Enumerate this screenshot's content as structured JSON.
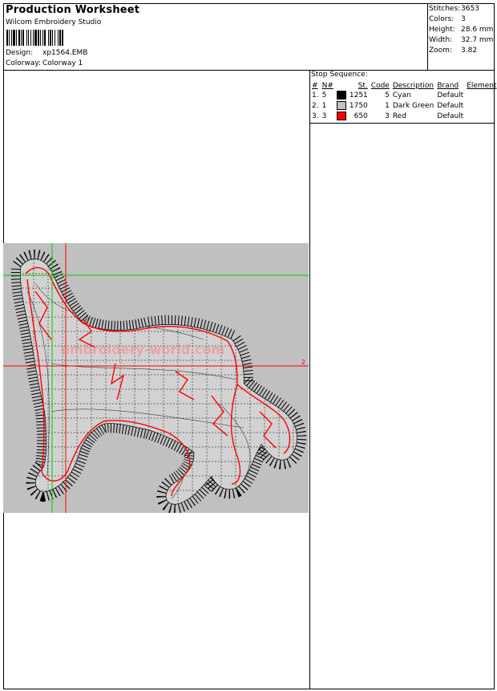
{
  "header": {
    "title": "Production Worksheet",
    "software": "Wilcom  Embroidery Studio",
    "design_label": "Design:",
    "design_value": "xp1564.EMB",
    "colorway_label": "Colorway:",
    "colorway_value": "Colorway 1"
  },
  "stats": [
    {
      "label": "Stitches:",
      "value": "3653"
    },
    {
      "label": "Colors:",
      "value": "3"
    },
    {
      "label": "Height:",
      "value": "28.6 mm"
    },
    {
      "label": "Width:",
      "value": "32.7 mm"
    },
    {
      "label": "Zoom:",
      "value": "3.82"
    }
  ],
  "stop_sequence": {
    "title": "Stop Sequence:",
    "columns": [
      "#",
      "N#",
      "St.",
      "Code",
      "Description",
      "Brand",
      "Element"
    ],
    "rows": [
      {
        "idx": "1.",
        "n": "5",
        "color": "#000000",
        "st": "1251",
        "code": "5",
        "desc": "Cyan",
        "brand": "Default",
        "element": ""
      },
      {
        "idx": "2.",
        "n": "1",
        "color": "#c0c0c0",
        "st": "1750",
        "code": "1",
        "desc": "Dark Green",
        "brand": "Default",
        "element": ""
      },
      {
        "idx": "3.",
        "n": "3",
        "color": "#ff0000",
        "st": "650",
        "code": "3",
        "desc": "Red",
        "brand": "Default",
        "element": ""
      }
    ]
  },
  "preview": {
    "axis_marker": "2",
    "watermark": "embroidery-world.com",
    "colors": {
      "background": "#c0c0c0",
      "stitch": "#000000",
      "outline": "#ff0000",
      "guide_green": "#00cc00",
      "guide_red": "#ff0000"
    }
  }
}
